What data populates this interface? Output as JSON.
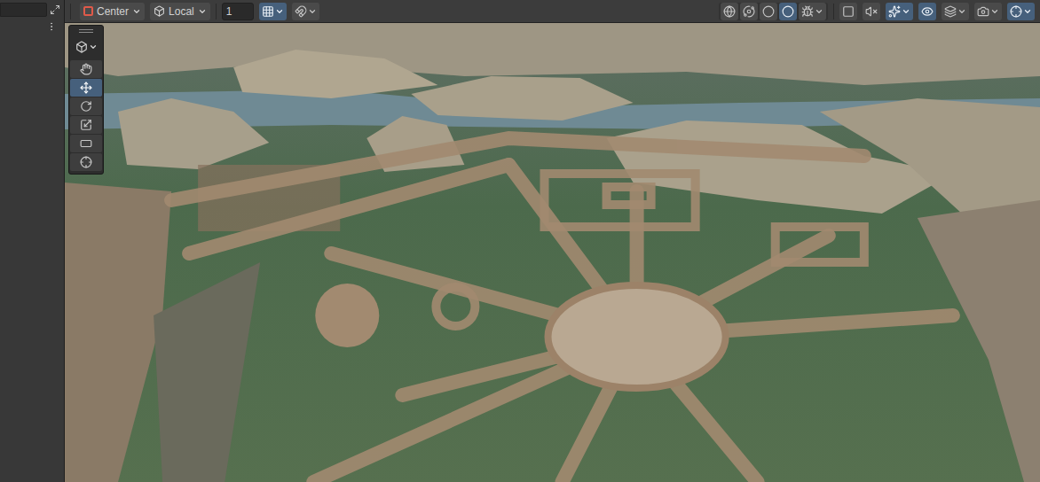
{
  "toolbar": {
    "pivot_mode": {
      "label": "Center"
    },
    "pivot_rotation": {
      "label": "Local"
    },
    "snap": {
      "value": "1"
    },
    "snap_toggles": [
      {
        "kind": "grid",
        "on": true
      },
      {
        "kind": "increment",
        "on": false
      }
    ],
    "view_toggles": [
      {
        "kind": "wireframe",
        "on": false
      },
      {
        "kind": "shaded-wireframe",
        "on": false
      },
      {
        "kind": "unlit",
        "on": false
      },
      {
        "kind": "shaded",
        "on": true
      },
      {
        "kind": "debug",
        "on": false
      }
    ],
    "scene_toggles": [
      {
        "kind": "2d",
        "on": false
      },
      {
        "kind": "audio",
        "on": false
      },
      {
        "kind": "effects",
        "on": true
      },
      {
        "kind": "visibility",
        "on": true
      },
      {
        "kind": "layers",
        "on": false
      },
      {
        "kind": "camera",
        "on": false
      },
      {
        "kind": "gizmos",
        "on": true
      }
    ]
  },
  "tools": [
    {
      "kind": "hand",
      "selected": false
    },
    {
      "kind": "move",
      "selected": true
    },
    {
      "kind": "rotate",
      "selected": false
    },
    {
      "kind": "scale",
      "selected": false
    },
    {
      "kind": "rect",
      "selected": false
    },
    {
      "kind": "transform",
      "selected": false
    }
  ]
}
